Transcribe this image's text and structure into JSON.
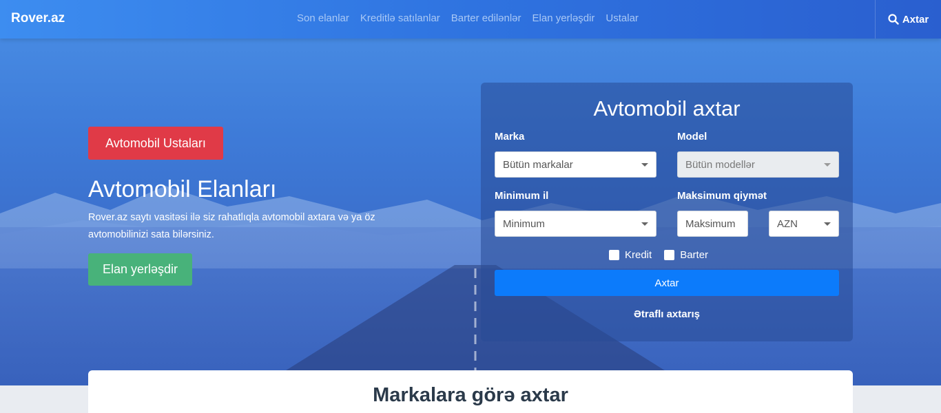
{
  "navbar": {
    "brand": "Rover.az",
    "links": [
      "Son elanlar",
      "Kreditlə satılanlar",
      "Barter edilənlər",
      "Elan yerləşdir",
      "Ustalar"
    ],
    "search_label": "Axtar"
  },
  "hero": {
    "masters_button": "Avtomobil Ustaları",
    "title": "Avtomobil Elanları",
    "description": "Rover.az saytı vasitəsi ilə siz rahatlıqla avtomobil axtara və ya öz avtomobilinizi sata bilərsiniz.",
    "post_button": "Elan yerləşdir"
  },
  "search_panel": {
    "title": "Avtomobil axtar",
    "make_label": "Marka",
    "make_value": "Bütün markalar",
    "model_label": "Model",
    "model_value": "Bütün modellər",
    "min_year_label": "Minimum il",
    "min_year_value": "Minimum",
    "max_price_label": "Maksimum qiymət",
    "max_price_placeholder": "Maksimum",
    "currency_value": "AZN",
    "credit_label": "Kredit",
    "barter_label": "Barter",
    "search_button": "Axtar",
    "advanced_link": "Ətraflı axtarış"
  },
  "brands_card": {
    "title": "Markalara görə axtar"
  },
  "colors": {
    "primary": "#0c7bfb",
    "danger": "#e03a47",
    "success": "#48b27a"
  }
}
